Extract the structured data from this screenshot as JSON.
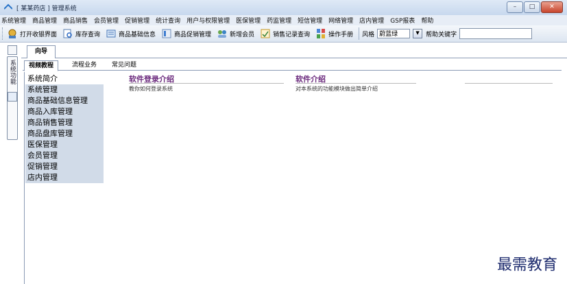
{
  "window": {
    "title": "[ 某某药店 ] 管理系统"
  },
  "menu": [
    "系统管理",
    "商品管理",
    "商品销售",
    "会员管理",
    "促销管理",
    "统计查询",
    "用户与权限管理",
    "医保管理",
    "药监管理",
    "短信管理",
    "网络管理",
    "店内管理",
    "GSP报表",
    "帮助"
  ],
  "toolbar": {
    "buttons": [
      {
        "label": "打开收银界面",
        "icon": "cash-register-icon"
      },
      {
        "label": "库存查询",
        "icon": "inventory-search-icon"
      },
      {
        "label": "商品基础信息",
        "icon": "product-info-icon"
      },
      {
        "label": "商品促销管理",
        "icon": "promotion-icon"
      },
      {
        "label": "新增会员",
        "icon": "new-member-icon"
      },
      {
        "label": "销售记录查询",
        "icon": "sales-record-icon"
      },
      {
        "label": "操作手册",
        "icon": "manual-icon"
      }
    ],
    "style_label": "风格",
    "style_value": "蔚蓝绿",
    "help_label": "帮助关键字",
    "help_value": ""
  },
  "left_strip": {
    "vertical_tab": "系统功能"
  },
  "outer_tab": "向导",
  "inner_tabs": [
    "视频教程",
    "流程业务",
    "常见问题"
  ],
  "nav_items": [
    "系统简介",
    "系统管理",
    "商品基础信息管理",
    "商品入库管理",
    "商品销售管理",
    "商品盘库管理",
    "医保管理",
    "会员管理",
    "促销管理",
    "店内管理"
  ],
  "sections": [
    {
      "title": "软件登录介绍",
      "desc": "教你如何登录系统"
    },
    {
      "title": "软件介绍",
      "desc": "对本系统的功能模块做出简单介绍"
    }
  ],
  "watermark": "最需教育",
  "colors": {
    "section_title": "#6b2a7d",
    "nav_bg": "#d1dbe8",
    "titlebar": "#c7d8ee"
  }
}
